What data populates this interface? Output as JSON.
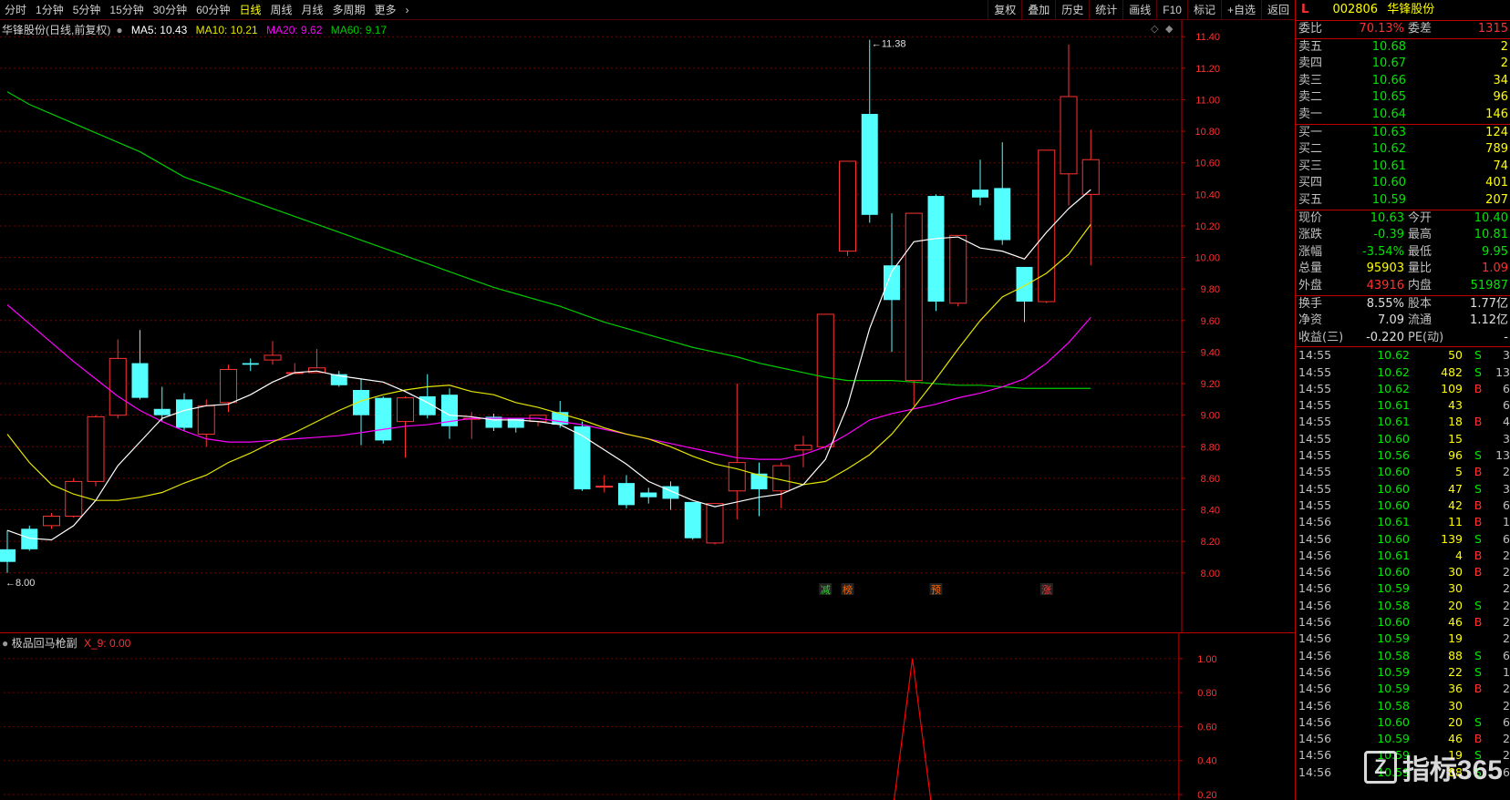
{
  "toolbar": {
    "tabs": [
      "分时",
      "1分钟",
      "5分钟",
      "15分钟",
      "30分钟",
      "60分钟",
      "日线",
      "周线",
      "月线",
      "多周期",
      "更多"
    ],
    "active_tab": "日线",
    "tools": [
      "复权",
      "叠加",
      "历史",
      "统计",
      "画线",
      "F10",
      "标记",
      "+自选",
      "返回"
    ]
  },
  "legend": {
    "title": "华锋股份(日线,前复权)",
    "ma5": "MA5: 10.43",
    "ma10": "MA10: 10.21",
    "ma20": "MA20: 9.62",
    "ma60": "MA60: 9.17",
    "colors": {
      "ma5": "#ffffff",
      "ma10": "#e6e600",
      "ma20": "#ff00ff",
      "ma60": "#00cc00"
    }
  },
  "sub_legend": {
    "title": "极品回马枪副",
    "value": "X_9: 0.00"
  },
  "chart_data": [
    {
      "type": "candlestick",
      "yticks": [
        "11.40",
        "11.20",
        "11.00",
        "10.80",
        "10.60",
        "10.40",
        "10.20",
        "10.00",
        "9.80",
        "9.60",
        "9.40",
        "9.20",
        "9.00",
        "8.80",
        "8.60",
        "8.40",
        "8.20",
        "8.00"
      ],
      "ylim": [
        7.97,
        11.43
      ],
      "high_label": "11.38",
      "low_label": "8.00",
      "candles": [
        [
          8.15,
          8.07,
          8.27,
          8.0
        ],
        [
          8.28,
          8.15,
          8.3,
          8.14
        ],
        [
          8.3,
          8.36,
          8.38,
          8.28
        ],
        [
          8.36,
          8.58,
          8.6,
          8.35
        ],
        [
          8.58,
          8.99,
          9.0,
          8.55
        ],
        [
          9.0,
          9.36,
          9.48,
          8.98
        ],
        [
          9.33,
          9.11,
          9.54,
          9.1
        ],
        [
          9.04,
          9.0,
          9.18,
          8.96
        ],
        [
          9.1,
          8.92,
          9.14,
          8.9
        ],
        [
          8.88,
          9.06,
          9.1,
          8.8
        ],
        [
          9.08,
          9.29,
          9.32,
          9.02
        ],
        [
          9.33,
          9.32,
          9.36,
          9.28
        ],
        [
          9.35,
          9.38,
          9.47,
          9.32
        ],
        [
          9.27,
          9.27,
          9.33,
          9.26
        ],
        [
          9.27,
          9.3,
          9.42,
          9.27
        ],
        [
          9.26,
          9.19,
          9.28,
          9.18
        ],
        [
          9.16,
          9.0,
          9.23,
          8.81
        ],
        [
          9.11,
          8.84,
          9.12,
          8.82
        ],
        [
          8.96,
          9.11,
          9.12,
          8.73
        ],
        [
          9.12,
          9.0,
          9.26,
          8.98
        ],
        [
          9.13,
          8.93,
          9.17,
          8.85
        ],
        [
          8.98,
          8.98,
          9.02,
          8.85
        ],
        [
          8.99,
          8.92,
          9.01,
          8.9
        ],
        [
          8.98,
          8.92,
          8.98,
          8.89
        ],
        [
          8.96,
          9.0,
          9.0,
          8.93
        ],
        [
          9.02,
          8.94,
          9.09,
          8.92
        ],
        [
          8.93,
          8.53,
          8.96,
          8.52
        ],
        [
          8.55,
          8.55,
          8.62,
          8.51
        ],
        [
          8.57,
          8.43,
          8.62,
          8.41
        ],
        [
          8.51,
          8.48,
          8.54,
          8.44
        ],
        [
          8.55,
          8.47,
          8.58,
          8.4
        ],
        [
          8.45,
          8.22,
          8.45,
          8.21
        ],
        [
          8.19,
          8.44,
          8.44,
          8.18
        ],
        [
          8.52,
          8.7,
          9.2,
          8.34
        ],
        [
          8.63,
          8.53,
          8.7,
          8.36
        ],
        [
          8.52,
          8.68,
          8.7,
          8.41
        ],
        [
          8.78,
          8.81,
          8.87,
          8.67
        ],
        [
          8.8,
          9.64,
          9.64,
          8.78
        ],
        [
          10.04,
          10.61,
          10.61,
          10.01
        ],
        [
          10.91,
          10.27,
          11.38,
          10.22
        ],
        [
          9.95,
          9.73,
          10.28,
          9.4
        ],
        [
          9.22,
          10.28,
          10.28,
          9.06
        ],
        [
          10.39,
          9.72,
          10.4,
          9.66
        ],
        [
          9.71,
          10.14,
          10.14,
          9.69
        ],
        [
          10.43,
          10.38,
          10.62,
          10.33
        ],
        [
          10.44,
          10.11,
          10.73,
          10.08
        ],
        [
          9.94,
          9.72,
          9.94,
          9.59
        ],
        [
          9.72,
          10.68,
          10.68,
          9.71
        ],
        [
          10.53,
          11.02,
          11.35,
          10.33
        ],
        [
          10.4,
          10.62,
          10.81,
          9.95
        ]
      ],
      "ma5": [
        8.27,
        8.22,
        8.21,
        8.3,
        8.46,
        8.68,
        8.83,
        8.98,
        9.03,
        9.06,
        9.07,
        9.13,
        9.21,
        9.27,
        9.28,
        9.25,
        9.23,
        9.21,
        9.15,
        9.08,
        9.0,
        8.99,
        8.97,
        8.97,
        8.96,
        8.94,
        8.87,
        8.78,
        8.69,
        8.58,
        8.52,
        8.46,
        8.42,
        8.45,
        8.48,
        8.5,
        8.56,
        8.72,
        9.06,
        9.55,
        9.91,
        10.1,
        10.12,
        10.13,
        10.06,
        10.04,
        9.99,
        10.16,
        10.31,
        10.43
      ],
      "ma10": [
        8.88,
        8.7,
        8.56,
        8.5,
        8.46,
        8.46,
        8.48,
        8.51,
        8.57,
        8.62,
        8.7,
        8.76,
        8.83,
        8.89,
        8.96,
        9.03,
        9.09,
        9.13,
        9.16,
        9.18,
        9.19,
        9.15,
        9.13,
        9.08,
        9.05,
        9.01,
        8.97,
        8.92,
        8.88,
        8.85,
        8.8,
        8.74,
        8.69,
        8.66,
        8.62,
        8.59,
        8.56,
        8.58,
        8.66,
        8.75,
        8.88,
        9.05,
        9.23,
        9.42,
        9.6,
        9.75,
        9.82,
        9.9,
        10.02,
        10.21
      ],
      "ma20": [
        9.7,
        9.58,
        9.46,
        9.34,
        9.23,
        9.12,
        9.03,
        8.96,
        8.9,
        8.85,
        8.83,
        8.83,
        8.84,
        8.85,
        8.86,
        8.87,
        8.89,
        8.91,
        8.93,
        8.94,
        8.96,
        8.98,
        8.98,
        8.98,
        8.98,
        8.96,
        8.94,
        8.91,
        8.88,
        8.85,
        8.82,
        8.79,
        8.76,
        8.73,
        8.72,
        8.72,
        8.75,
        8.8,
        8.88,
        8.97,
        9.01,
        9.04,
        9.07,
        9.11,
        9.14,
        9.18,
        9.23,
        9.33,
        9.46,
        9.62
      ],
      "ma60": [
        11.05,
        10.97,
        10.91,
        10.85,
        10.79,
        10.73,
        10.67,
        10.59,
        10.51,
        10.46,
        10.41,
        10.36,
        10.31,
        10.26,
        10.21,
        10.16,
        10.11,
        10.06,
        10.01,
        9.96,
        9.91,
        9.86,
        9.81,
        9.77,
        9.73,
        9.69,
        9.64,
        9.59,
        9.55,
        9.51,
        9.47,
        9.43,
        9.4,
        9.37,
        9.33,
        9.3,
        9.27,
        9.24,
        9.22,
        9.22,
        9.22,
        9.21,
        9.2,
        9.19,
        9.19,
        9.18,
        9.17,
        9.17,
        9.17,
        9.17
      ],
      "markers": [
        {
          "index": 37,
          "text": "减",
          "color": "#33cc33"
        },
        {
          "index": 38,
          "text": "榜",
          "color": "#ff6600"
        },
        {
          "index": 42,
          "text": "预",
          "color": "#ff6600"
        },
        {
          "index": 47,
          "text": "涨",
          "color": "#ff3030"
        }
      ]
    },
    {
      "type": "line",
      "yticks": [
        "1.00",
        "0.80",
        "0.60",
        "0.40",
        "0.20"
      ],
      "ylim": [
        0.18,
        1.0
      ],
      "x": [
        40,
        41,
        42
      ],
      "values": [
        0.0,
        1.0,
        0.0
      ]
    }
  ],
  "quote": {
    "code": "002806",
    "name": "华锋股份",
    "badge": "L",
    "ratio": {
      "l1": "委比",
      "v1": "70.13%",
      "l2": "委差",
      "v2": "1315"
    },
    "asks": [
      {
        "label": "卖五",
        "price": "10.68",
        "vol": "2"
      },
      {
        "label": "卖四",
        "price": "10.67",
        "vol": "2"
      },
      {
        "label": "卖三",
        "price": "10.66",
        "vol": "34"
      },
      {
        "label": "卖二",
        "price": "10.65",
        "vol": "96"
      },
      {
        "label": "卖一",
        "price": "10.64",
        "vol": "146"
      }
    ],
    "bids": [
      {
        "label": "买一",
        "price": "10.63",
        "vol": "124"
      },
      {
        "label": "买二",
        "price": "10.62",
        "vol": "789"
      },
      {
        "label": "买三",
        "price": "10.61",
        "vol": "74"
      },
      {
        "label": "买四",
        "price": "10.60",
        "vol": "401"
      },
      {
        "label": "买五",
        "price": "10.59",
        "vol": "207"
      }
    ],
    "stats": [
      {
        "l1": "现价",
        "v1": "10.63",
        "c1": "green",
        "l2": "今开",
        "v2": "10.40",
        "c2": "green"
      },
      {
        "l1": "涨跌",
        "v1": "-0.39",
        "c1": "green",
        "l2": "最高",
        "v2": "10.81",
        "c2": "green"
      },
      {
        "l1": "涨幅",
        "v1": "-3.54%",
        "c1": "green",
        "l2": "最低",
        "v2": "9.95",
        "c2": "green"
      },
      {
        "l1": "总量",
        "v1": "95903",
        "c1": "yellow",
        "l2": "量比",
        "v2": "1.09",
        "c2": "red"
      },
      {
        "l1": "外盘",
        "v1": "43916",
        "c1": "red",
        "l2": "内盘",
        "v2": "51987",
        "c2": "green"
      }
    ],
    "stats2": [
      {
        "l1": "换手",
        "v1": "8.55%",
        "l2": "股本",
        "v2": "1.77亿"
      },
      {
        "l1": "净资",
        "v1": "7.09",
        "l2": "流通",
        "v2": "1.12亿"
      },
      {
        "l1": "收益(三)",
        "v1": "-0.220",
        "l2": "PE(动)",
        "v2": "-"
      }
    ],
    "ticks": [
      {
        "t": "14:55",
        "p": "10.62",
        "q": "50",
        "d": "S",
        "n": "3"
      },
      {
        "t": "14:55",
        "p": "10.62",
        "q": "482",
        "d": "S",
        "n": "13"
      },
      {
        "t": "14:55",
        "p": "10.62",
        "q": "109",
        "d": "B",
        "n": "6"
      },
      {
        "t": "14:55",
        "p": "10.61",
        "q": "43",
        "d": "",
        "n": "6"
      },
      {
        "t": "14:55",
        "p": "10.61",
        "q": "18",
        "d": "B",
        "n": "4"
      },
      {
        "t": "14:55",
        "p": "10.60",
        "q": "15",
        "d": "",
        "n": "3"
      },
      {
        "t": "14:55",
        "p": "10.56",
        "q": "96",
        "d": "S",
        "n": "13"
      },
      {
        "t": "14:55",
        "p": "10.60",
        "q": "5",
        "d": "B",
        "n": "2"
      },
      {
        "t": "14:55",
        "p": "10.60",
        "q": "47",
        "d": "S",
        "n": "3"
      },
      {
        "t": "14:55",
        "p": "10.60",
        "q": "42",
        "d": "B",
        "n": "6"
      },
      {
        "t": "14:56",
        "p": "10.61",
        "q": "11",
        "d": "B",
        "n": "1"
      },
      {
        "t": "14:56",
        "p": "10.60",
        "q": "139",
        "d": "S",
        "n": "6"
      },
      {
        "t": "14:56",
        "p": "10.61",
        "q": "4",
        "d": "B",
        "n": "2"
      },
      {
        "t": "14:56",
        "p": "10.60",
        "q": "30",
        "d": "B",
        "n": "2"
      },
      {
        "t": "14:56",
        "p": "10.59",
        "q": "30",
        "d": "",
        "n": "2"
      },
      {
        "t": "14:56",
        "p": "10.58",
        "q": "20",
        "d": "S",
        "n": "2"
      },
      {
        "t": "14:56",
        "p": "10.60",
        "q": "46",
        "d": "B",
        "n": "2"
      },
      {
        "t": "14:56",
        "p": "10.59",
        "q": "19",
        "d": "",
        "n": "2"
      },
      {
        "t": "14:56",
        "p": "10.58",
        "q": "88",
        "d": "S",
        "n": "6"
      },
      {
        "t": "14:56",
        "p": "10.59",
        "q": "22",
        "d": "S",
        "n": "1"
      },
      {
        "t": "14:56",
        "p": "10.59",
        "q": "36",
        "d": "B",
        "n": "2"
      },
      {
        "t": "14:56",
        "p": "10.58",
        "q": "30",
        "d": "",
        "n": "2"
      },
      {
        "t": "14:56",
        "p": "10.60",
        "q": "20",
        "d": "S",
        "n": "6"
      },
      {
        "t": "14:56",
        "p": "10.59",
        "q": "46",
        "d": "B",
        "n": "2"
      },
      {
        "t": "14:56",
        "p": "10.59",
        "q": "19",
        "d": "S",
        "n": "2"
      },
      {
        "t": "14:56",
        "p": "10.59",
        "q": "88",
        "d": "S",
        "n": "6"
      }
    ]
  },
  "watermark": {
    "text": "指标365",
    "mark": "Z"
  },
  "colors": {
    "up": "#ff3232",
    "down": "#54ffff",
    "grid": "#7a0000",
    "axis": "#c00000",
    "signal": "#ff0000"
  }
}
